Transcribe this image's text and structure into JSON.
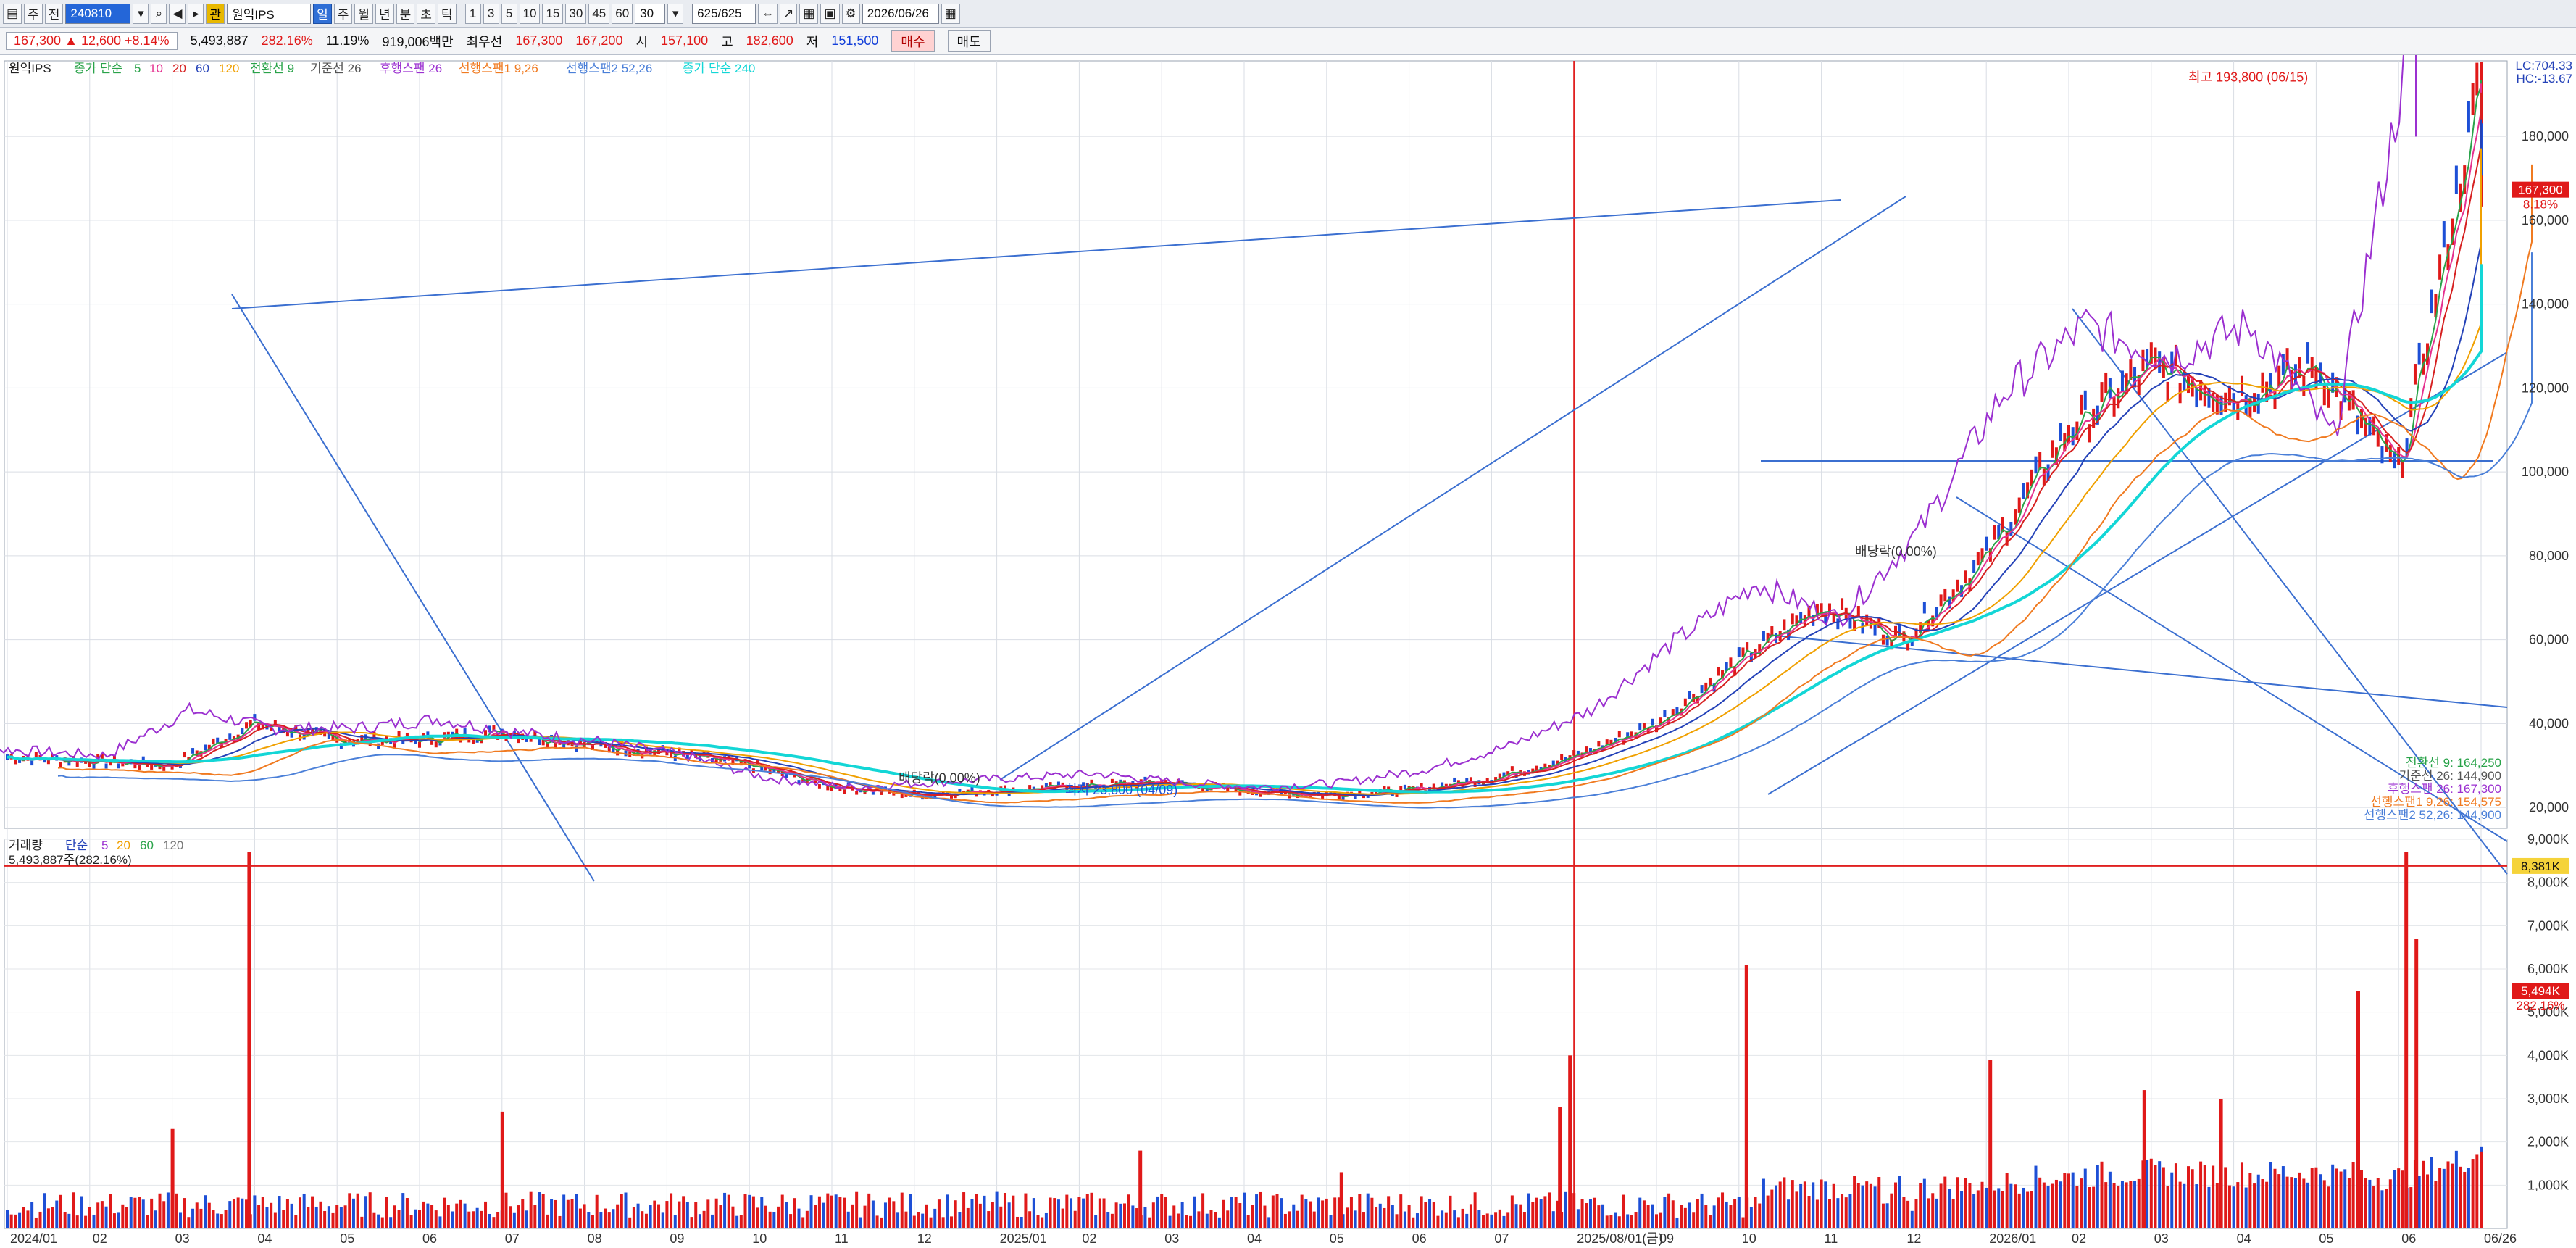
{
  "toolbar": {
    "code": "240810",
    "name": "원익IPS",
    "period_buttons": [
      "주",
      "월",
      "년",
      "분",
      "초",
      "틱"
    ],
    "minute_buttons": [
      "1",
      "3",
      "5",
      "10",
      "15",
      "30",
      "45",
      "60"
    ],
    "interval_value": "30",
    "count_display": "625/625",
    "date": "2026/06/26"
  },
  "quote": {
    "price": "167,300",
    "change": "12,600",
    "change_pct": "+8.14%",
    "volume": "5,493,887",
    "volume_ratio": "282.16%",
    "turnover_rate": "11.19%",
    "amount": "919,006백만",
    "best_ask_label": "최우선",
    "best_ask": "167,300",
    "best_bid": "167,200",
    "open_label": "시",
    "open": "157,100",
    "high_label": "고",
    "high": "182,600",
    "low_label": "저",
    "low": "151,500",
    "buy_label": "매수",
    "sell_label": "매도"
  },
  "chart_data": [
    {
      "type": "line",
      "title": "원익IPS",
      "legend": [
        {
          "name": "종가 단순",
          "periods": [
            "5",
            "10",
            "20",
            "60",
            "120"
          ],
          "colors": [
            "#2aa34a",
            "#e5308f",
            "#d62020",
            "#2442b8",
            "#f0a000"
          ]
        },
        {
          "name": "전환선 9",
          "color": "#2aa34a"
        },
        {
          "name": "기준선 26",
          "color": "#555555"
        },
        {
          "name": "후행스팬 26",
          "color": "#9b30d0"
        },
        {
          "name": "선행스팬1 9,26",
          "color": "#f07a20"
        },
        {
          "name": "선행스팬2 52,26",
          "color": "#4a7fd8"
        },
        {
          "name": "종가 단순 240",
          "color": "#13d6d6"
        }
      ],
      "x_tick_labels": [
        "2024/01",
        "02",
        "03",
        "04",
        "05",
        "06",
        "07",
        "08",
        "09",
        "10",
        "11",
        "12",
        "2025/01",
        "02",
        "03",
        "04",
        "05",
        "06",
        "07",
        "2025/08/01(금)",
        "09",
        "10",
        "11",
        "12",
        "2026/01",
        "02",
        "03",
        "04",
        "05",
        "06",
        "06/26"
      ],
      "y_tick_labels": [
        "180,000",
        "160,000",
        "140,000",
        "120,000",
        "100,000",
        "80,000",
        "60,000",
        "40,000",
        "20,000"
      ],
      "ylim": [
        15000,
        198000
      ],
      "grid": true,
      "lc": "LC:704.33",
      "hc": "HC:-13.67",
      "current_price_label": "167,300",
      "current_price_pct": "8.18%",
      "annotations": {
        "high": "최고 193,800 (06/15)",
        "low": "최저 23,800 (04/09)",
        "fall1": "배당락(0.00%)",
        "fall2": "배당락(0.00%)"
      },
      "ichimoku_values": [
        {
          "label": "전환선 9: 164,250",
          "color": "#2aa34a"
        },
        {
          "label": "기준선 26: 144,900",
          "color": "#555555"
        },
        {
          "label": "후행스팬 26: 167,300",
          "color": "#9b30d0"
        },
        {
          "label": "선행스팬1 9,26: 154,575",
          "color": "#f07a20"
        },
        {
          "label": "선행스팬2 52,26: 144,900",
          "color": "#4a7fd8"
        }
      ],
      "close_series": [
        {
          "date": "2024/01",
          "v": 32000
        },
        {
          "date": "02",
          "v": 31000
        },
        {
          "date": "03",
          "v": 30000
        },
        {
          "date": "04",
          "v": 40000
        },
        {
          "date": "05",
          "v": 36000
        },
        {
          "date": "06",
          "v": 36000
        },
        {
          "date": "07",
          "v": 38000
        },
        {
          "date": "08",
          "v": 35000
        },
        {
          "date": "09",
          "v": 33000
        },
        {
          "date": "10",
          "v": 30000
        },
        {
          "date": "11",
          "v": 25000
        },
        {
          "date": "12",
          "v": 23000
        },
        {
          "date": "2025/01",
          "v": 24000
        },
        {
          "date": "02",
          "v": 25000
        },
        {
          "date": "03",
          "v": 26000
        },
        {
          "date": "04",
          "v": 24000
        },
        {
          "date": "05",
          "v": 23000
        },
        {
          "date": "06",
          "v": 24000
        },
        {
          "date": "07",
          "v": 27000
        },
        {
          "date": "08",
          "v": 32000
        },
        {
          "date": "09",
          "v": 40000
        },
        {
          "date": "10",
          "v": 55000
        },
        {
          "date": "11",
          "v": 68000
        },
        {
          "date": "12",
          "v": 60000
        },
        {
          "date": "2026/01",
          "v": 80000
        },
        {
          "date": "02",
          "v": 110000
        },
        {
          "date": "03",
          "v": 125000
        },
        {
          "date": "04",
          "v": 118000
        },
        {
          "date": "05",
          "v": 125000
        },
        {
          "date": "06",
          "v": 100000
        },
        {
          "date": "06/15",
          "v": 193800
        },
        {
          "date": "06/26",
          "v": 167300
        }
      ]
    },
    {
      "type": "bar",
      "title": "거래량",
      "legend": [
        {
          "name": "단순",
          "periods": [
            "5",
            "20",
            "60",
            "120"
          ],
          "colors": [
            "#9b30d0",
            "#f0a000",
            "#2aa34a",
            "#777777"
          ]
        }
      ],
      "header_value": "5,493,887주(282.16%)",
      "y_tick_labels": [
        "9,000K",
        "8,000K",
        "7,000K",
        "6,000K",
        "5,000K",
        "4,000K",
        "3,000K",
        "2,000K",
        "1,000K"
      ],
      "ylim": [
        0,
        9000000
      ],
      "ref_line_label": "8,381K",
      "current_label": "5,494K",
      "current_pct": "282.16%",
      "spikes": [
        {
          "date": "2024/03",
          "v": 2300000
        },
        {
          "date": "2024/04",
          "v": 8700000
        },
        {
          "date": "2024/07",
          "v": 2700000
        },
        {
          "date": "2025/03",
          "v": 1800000
        },
        {
          "date": "2025/05",
          "v": 1300000
        },
        {
          "date": "2025/08",
          "v": 2800000
        },
        {
          "date": "2025/08",
          "v": 4000000
        },
        {
          "date": "2025/10",
          "v": 6100000
        },
        {
          "date": "2026/01",
          "v": 3900000
        },
        {
          "date": "2026/03",
          "v": 3200000
        },
        {
          "date": "2026/04",
          "v": 3000000
        },
        {
          "date": "2026/06",
          "v": 8700000
        },
        {
          "date": "2026/06",
          "v": 6700000
        },
        {
          "date": "06/26",
          "v": 5494000
        }
      ]
    }
  ]
}
